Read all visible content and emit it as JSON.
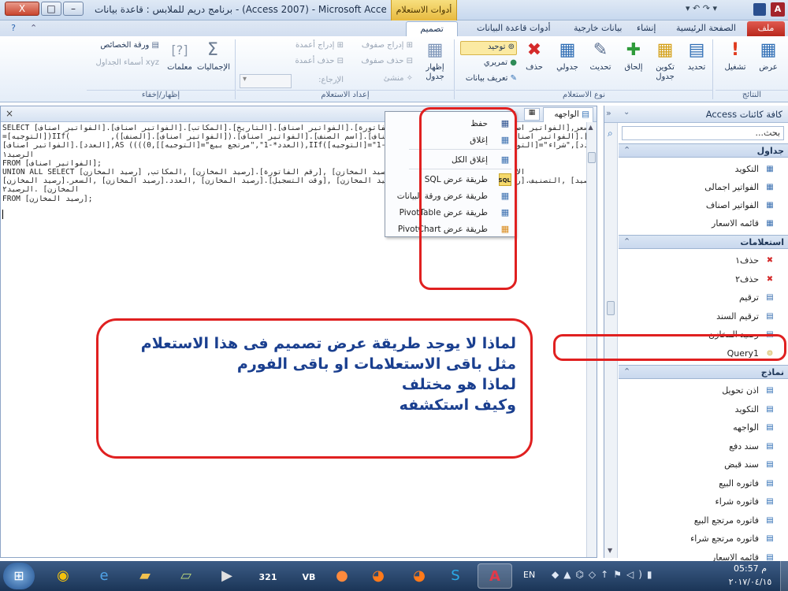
{
  "window": {
    "title": "برنامج دريم للملابس : قاعدة بيانات - (Access 2007) - Microsoft Access",
    "context_tab_header": "أدوات الاستعلام",
    "close_label": "X",
    "max_label": "□",
    "min_label": "–"
  },
  "ribbon_tabs": {
    "file": "ملف",
    "home": "الصفحة الرئيسية",
    "create": "إنشاء",
    "external": "بيانات خارجية",
    "dbtools": "أدوات قاعدة البيانات",
    "design": "تصميم"
  },
  "ribbon": {
    "results": {
      "view": "عرض",
      "run": "تشغيل",
      "group": "النتائج"
    },
    "query_type": {
      "select": "تحديد",
      "make_table": "تكوين جدول",
      "append": "إلحاق",
      "update": "تحديث",
      "crosstab": "جدولي",
      "delete": "حذف",
      "union": "توحيد",
      "passthrough": "تمريري",
      "data_def": "تعريف بيانات",
      "group": "نوع الاستعلام"
    },
    "query_setup": {
      "show_table": "إظهار جدول",
      "insert_rows": "إدراج صفوف",
      "delete_rows": "حذف صفوف",
      "builder": "منشئ",
      "insert_cols": "إدراج أعمدة",
      "delete_cols": "حذف أعمدة",
      "return": "الإرجاع:",
      "group": "إعداد الاستعلام"
    },
    "show_hide": {
      "totals": "الإجماليات",
      "params": "معلمات",
      "property_sheet": "ورقة الخصائص",
      "table_names": "أسماء الجداول",
      "group": "إظهار/إخفاء"
    }
  },
  "editor": {
    "tab_label": "الواجهه",
    "close_label": "×",
    "sql_lines": [
      "SELECT [الفواتير اصناف].[الفواتير اصناف].[المكاتب].[السعر,[الفواتير اصناف].[الفواتير اصناف].[رقم الفاتورة].[الفواتير اصناف].[التاريخ.",
      "=[التوجيه])IIf(         ,([الصنف].[الفواتير اصناف]).[الفواتير اصناف].[اسم الصنف].[الفواتير اصناف].[وقت التسجيل].[الفواتير اصناف].[العدد.",
      "[الفواتير اصناف].[العدد],AS ((((0,[العدد*-1\",\"مرتجع بيع\"=[التوجيه]),IIf([التوجيه]=\"مرتجع شراء\",[العدد]*-1,IIf([التوجيه]=\"بيع\",[العدد],\"شراء\"",
      "الرصيد١",
      "FROM [الفواتير اصناف];",
      "UNION ALL SELECT [رصيد المخازن] ,الاسم.[رصيد المخازن] ,التاريخ.[رصيد المخازن] ,[رقم الفاتورة].[رصيد المخازن] ,المكاتب",
      "رصيد] ,التصنيف.[رصيد المخازن] ,[اسم الصنف].[رصيد المخازن] ,[وقت التسجيل].[رصيد المخازن] ,العدد.[رصيد المخازن] ,السعر.[رصيد المخازن]",
      "المخازن] .الرصيد٢",
      "FROM [رصيد المخازن];"
    ]
  },
  "context_menu": {
    "items": [
      {
        "label": "حفظ",
        "icon": "save-icon"
      },
      {
        "label": "إغلاق",
        "icon": "close-doc-icon"
      },
      {
        "label": "إغلاق الكل",
        "icon": "close-all-icon"
      },
      {
        "label": "طريقة عرض SQL",
        "icon": "sql-icon"
      },
      {
        "label": "طريقة عرض ورقة البيانات",
        "icon": "datasheet-icon"
      },
      {
        "label": "طريقة عرض PivotTable",
        "icon": "pivottable-icon"
      },
      {
        "label": "طريقة عرض PivotChart",
        "icon": "pivotchart-icon"
      }
    ]
  },
  "nav": {
    "title": "كافة كائنات Access",
    "search_placeholder": "بحث...",
    "groups": {
      "tables": {
        "label": "جداول",
        "items": [
          "التكويد",
          "الفواتير اجمالى",
          "الفواتير اصناف",
          "قائمه الاسعار"
        ]
      },
      "queries": {
        "label": "استعلامات",
        "items": [
          "حذف١",
          "حذف٢",
          "ترقيم",
          "ترقيم السند",
          "رصيد المخازن",
          "Query1"
        ]
      },
      "forms": {
        "label": "نماذج",
        "items": [
          "اذن تحويل",
          "التكويد",
          "الواجهه",
          "سند دفع",
          "سند قبض",
          "فاتوره البيع",
          "فاتوره شراء",
          "فاتوره مرتجع البيع",
          "فاتوره مرتجع شراء",
          "قائمه الاسعار"
        ]
      }
    }
  },
  "annotation": {
    "lines": [
      "لماذا لا يوجد طريقة عرض تصميم فى هذا الاستعلام",
      "مثل باقى الاستعلامات او باقى الفورم",
      "لماذا هو مختلف",
      "وكيف استكشفه"
    ]
  },
  "taskbar": {
    "lang": "EN",
    "time": "05:57 م",
    "date": "٢٠١٧/٠٤/١٥"
  },
  "colors": {
    "file_tab": "#b9271c",
    "annotation": "#e02020",
    "note_text": "#1a3f8f"
  }
}
